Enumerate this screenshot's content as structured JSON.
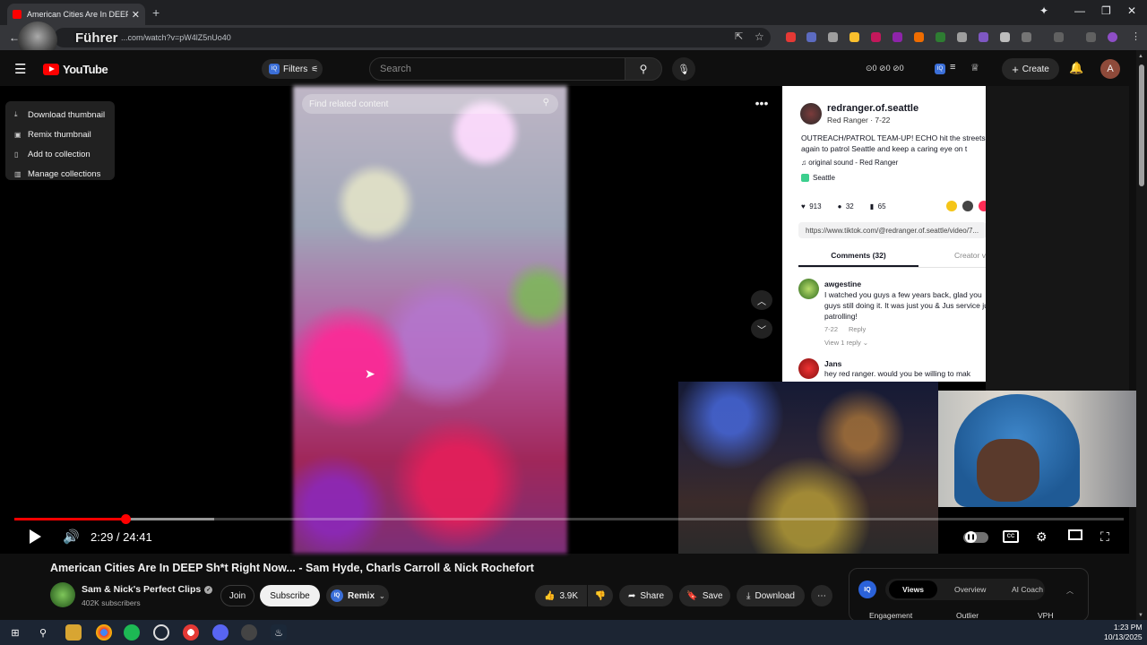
{
  "browser": {
    "tab_title": "American Cities Are In DEEP Sh...",
    "url": "...com/watch?v=pW4lZ5nUo40",
    "overlay_name": "Führer"
  },
  "youtube": {
    "logo": "YouTube",
    "filters_label": "Filters",
    "search_placeholder": "Search",
    "counts": "⊙0  ⊘0  ⊘0",
    "create_label": "Create",
    "avatar_letter": "A"
  },
  "thumbnail_menu": {
    "items": [
      {
        "label": "Download thumbnail",
        "icon": "download-icon"
      },
      {
        "label": "Remix thumbnail",
        "icon": "remix-icon"
      },
      {
        "label": "Add to collection",
        "icon": "add-collection-icon"
      },
      {
        "label": "Manage collections",
        "icon": "collections-icon"
      }
    ]
  },
  "player": {
    "find_related": "Find related content",
    "time": "2:29 / 24:41",
    "progress": {
      "played_fraction": 0.1,
      "buffered_fraction": 0.18
    }
  },
  "tiktok": {
    "username": "redranger.of.seattle",
    "sub": "Red Ranger · 7-22",
    "caption": "OUTREACH/PATROL TEAM-UP! ECHO hit the streets again to patrol Seattle and keep a caring eye on t",
    "sound": "♫  original sound - Red Ranger",
    "location": "Seattle",
    "likes": "913",
    "comments_count": "32",
    "saves": "65",
    "link": "https://www.tiktok.com/@redranger.of.seattle/video/7...",
    "tab_comments": "Comments (32)",
    "tab_creator": "Creator v",
    "comment1": {
      "name": "awgestine",
      "text": "I watched you guys a few years back, glad you guys still doing it. It was just you & Jus service just patrolling!",
      "date": "7-22",
      "reply": "Reply",
      "replies": "View 1 reply ⌄"
    },
    "comment2": {
      "name": "Jans",
      "text": "hey red ranger. would you be willing to mak"
    }
  },
  "video": {
    "title": "American Cities Are In DEEP Sh*t Right Now... - Sam Hyde, Charls Carroll & Nick Rochefort",
    "channel": "Sam & Nick's Perfect Clips",
    "subscribers": "402K subscribers",
    "join": "Join",
    "subscribe": "Subscribe",
    "remix": "Remix",
    "likes": "3.9K",
    "share": "Share",
    "save": "Save",
    "download": "Download"
  },
  "iq_panel": {
    "logo": "IQ",
    "tabs": [
      "Views",
      "Overview",
      "AI Coach"
    ],
    "columns": [
      "Engagement",
      "Outlier",
      "VPH"
    ]
  },
  "taskbar": {
    "time": "1:23 PM",
    "date": "10/13/2025"
  },
  "colors": {
    "accent_red": "#ff0000",
    "bg": "#0f0f0f",
    "iq_blue": "#2b62d9"
  }
}
